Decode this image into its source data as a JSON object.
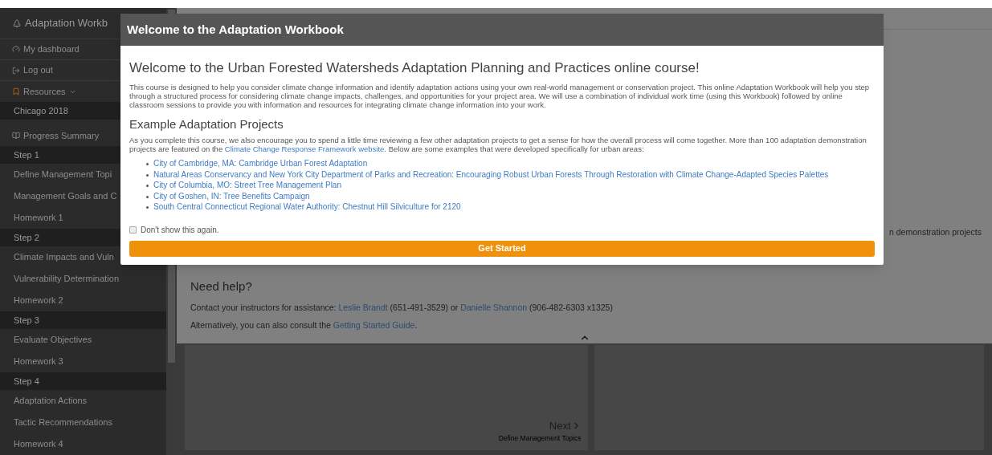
{
  "sidebar": {
    "brand": "Adaptation Workb",
    "links": [
      {
        "kind": "dashboard",
        "label": "My dashboard"
      },
      {
        "kind": "logout",
        "label": "Log out"
      },
      {
        "kind": "resources",
        "label": "Resources"
      }
    ],
    "project": "Chicago 2018",
    "progress": "Progress Summary",
    "sections": [
      {
        "title": "Step 1",
        "items": [
          "Define Management Topi",
          "Management Goals and C",
          "Homework 1"
        ]
      },
      {
        "title": "Step 2",
        "items": [
          "Climate Impacts and Vuln",
          "Vulnerability Determination",
          "Homework 2"
        ]
      },
      {
        "title": "Step 3",
        "items": [
          "Evaluate Objectives",
          "Homework 3"
        ]
      },
      {
        "title": "Step 4",
        "items": [
          "Adaptation Actions",
          "Tactic Recommendations",
          "Homework 4"
        ]
      }
    ]
  },
  "main": {
    "side_text": "n demonstration projects",
    "help_title": "Need help?",
    "contact": [
      {
        "kind": "text",
        "text": "Contact your instructors for assistance: "
      },
      {
        "kind": "link",
        "text": "Leslie Brandt"
      },
      {
        "kind": "text",
        "text": " (651-491-3529) or "
      },
      {
        "kind": "link",
        "text": "Danielle Shannon"
      },
      {
        "kind": "text",
        "text": " (906-482-6303 x1325)"
      }
    ],
    "alternative": [
      {
        "kind": "text",
        "text": "Alternatively, you can also consult the "
      },
      {
        "kind": "link",
        "text": "Getting Started Guide"
      },
      {
        "kind": "text",
        "text": "."
      }
    ],
    "next": {
      "label": "Next",
      "sublabel": "Define Management Topics"
    }
  },
  "dialog": {
    "title": "Welcome to the Adaptation Workbook",
    "heading": "Welcome to the Urban Forested Watersheds Adaptation Planning and Practices online course!",
    "intro": "This course is designed to help you consider climate change information and identify adaptation actions using your own real-world management or conservation project. This online Adaptation Workbook will help you step through a structured process for considering climate change impacts, challenges, and opportunities for your project area. We will use a combination of individual work time (using this Workbook) followed by online classroom sessions to provide you with information and resources for integrating climate change information into your work.",
    "examples_heading": "Example Adaptation Projects",
    "examples_intro": [
      {
        "kind": "text",
        "text": "As you complete this course, we also encourage you to spend a little time reviewing a few other adaptation projects to get a sense for how the overall process will come together. More than 100 adaptation demonstration projects are featured on the "
      },
      {
        "kind": "link",
        "text": "Climate Change Response Framework website"
      },
      {
        "kind": "text",
        "text": ". Below are some examples that were developed specifically for urban areas:"
      }
    ],
    "projects": [
      "City of Cambridge, MA: Cambridge Urban Forest Adaptation",
      "Natural Areas Conservancy and New York City Department of Parks and Recreation: Encouraging Robust Urban Forests Through Restoration with Climate Change-Adapted Species Palettes",
      "City of Columbia, MO: Street Tree Management Plan",
      "City of Goshen, IN: Tree Benefits Campaign",
      "South Central Connecticut Regional Water Authority: Chestnut Hill Silviculture for 2120"
    ],
    "dont_show": {
      "label": "Don't show this again.",
      "checked": false
    },
    "button": "Get Started"
  }
}
